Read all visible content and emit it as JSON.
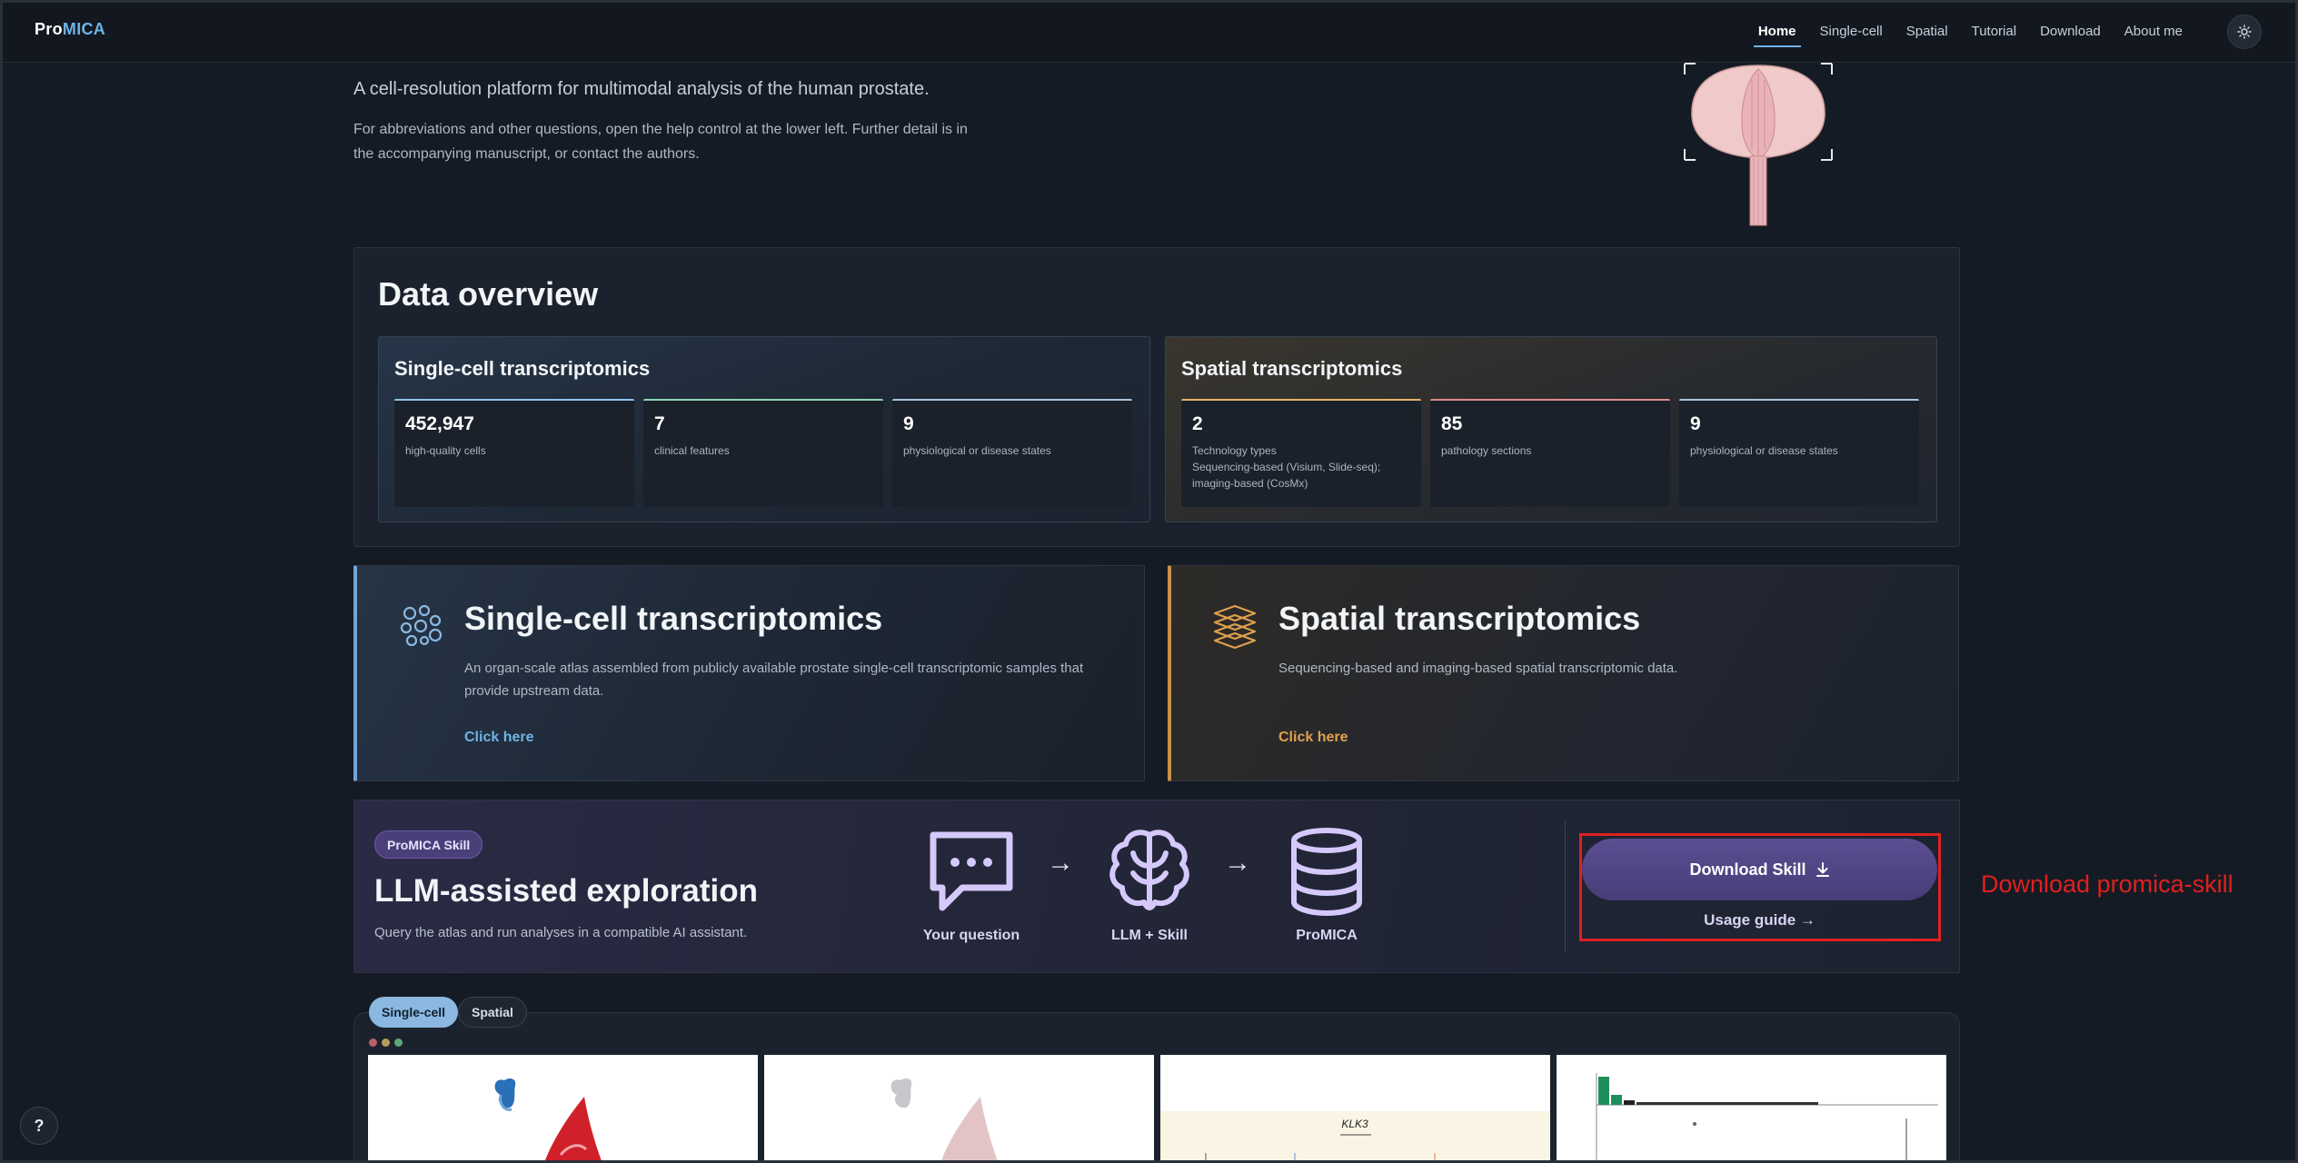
{
  "nav": {
    "brand_pro": "Pro",
    "brand_mica": "MICA",
    "links": [
      "Home",
      "Single-cell",
      "Spatial",
      "Tutorial",
      "Download",
      "About me"
    ],
    "active": "Home",
    "theme_icon": "sun-icon"
  },
  "hero": {
    "subtitle": "A cell-resolution platform for multimodal analysis of the human prostate.",
    "description": "For abbreviations and other questions, open the help control at the lower left. Further detail is in the accompanying manuscript, or contact the authors."
  },
  "overview": {
    "title": "Data overview",
    "single_cell": {
      "title": "Single-cell transcriptomics",
      "stats": [
        {
          "value": "452,947",
          "label": "high-quality cells",
          "accent": "#8fc3ec"
        },
        {
          "value": "7",
          "label": "clinical features",
          "accent": "#8fd4b3"
        },
        {
          "value": "9",
          "label": "physiological or disease states",
          "accent": "#a9c5dc"
        }
      ]
    },
    "spatial": {
      "title": "Spatial transcriptomics",
      "stats": [
        {
          "value": "2",
          "label": "Technology types",
          "detail": "Sequencing-based (Visium, Slide-seq); imaging-based (CosMx)",
          "accent": "#e5b46a"
        },
        {
          "value": "85",
          "label": "pathology sections",
          "accent": "#e08a8a"
        },
        {
          "value": "9",
          "label": "physiological or disease states",
          "accent": "#a9c5dc"
        }
      ]
    }
  },
  "features": {
    "single_cell": {
      "title": "Single-cell transcriptomics",
      "description": "An organ-scale atlas assembled from publicly available prostate single-cell transcriptomic samples that provide upstream data.",
      "link": "Click here",
      "icon": "cells-icon"
    },
    "spatial": {
      "title": "Spatial transcriptomics",
      "description": "Sequencing-based and imaging-based spatial transcriptomic data.",
      "link": "Click here",
      "icon": "layers-icon"
    }
  },
  "skill": {
    "badge": "ProMICA Skill",
    "title": "LLM-assisted exploration",
    "description": "Query the atlas and run analyses in a compatible AI assistant.",
    "flow": [
      {
        "label": "Your question",
        "icon": "chat-bubble-icon"
      },
      {
        "label": "LLM + Skill",
        "icon": "brain-icon"
      },
      {
        "label": "ProMICA",
        "icon": "database-icon"
      }
    ],
    "arrow": "→",
    "download_button": "Download Skill",
    "usage_guide": "Usage guide →",
    "annotation": "Download promica-skill"
  },
  "gallery": {
    "tabs": [
      "Single-cell",
      "Spatial"
    ],
    "active_tab": "Single-cell",
    "thumb3_label": "KLK3"
  },
  "help": {
    "label": "?"
  }
}
